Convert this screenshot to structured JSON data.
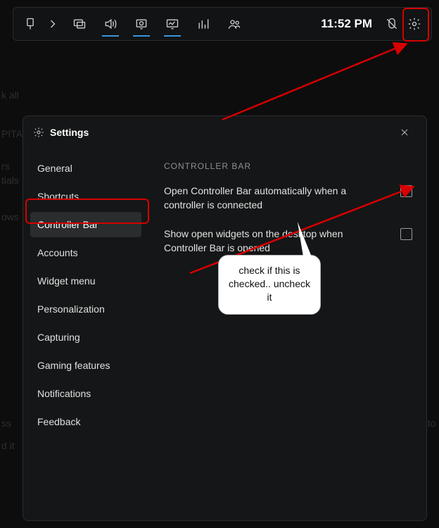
{
  "topbar": {
    "time": "11:52 PM",
    "icons": {
      "pin": "pin-icon",
      "chevron": "chevron-right-icon",
      "monitor": "monitor-icon",
      "volume": "volume-icon",
      "camera": "camera-icon",
      "perf": "performance-icon",
      "stats": "bar-chart-icon",
      "group": "group-icon",
      "mouse_off": "mouse-disabled-icon",
      "gear": "gear-icon"
    }
  },
  "background_fragments": {
    "a": "k all",
    "b": "PITA",
    "c": "rs",
    "d": "tials",
    "e": "ows",
    "f": "ss",
    "g": "d it",
    "h": "uto"
  },
  "panel": {
    "title": "Settings",
    "sidebar": {
      "items": [
        {
          "label": "General"
        },
        {
          "label": "Shortcuts"
        },
        {
          "label": "Controller Bar",
          "selected": true
        },
        {
          "label": "Accounts"
        },
        {
          "label": "Widget menu"
        },
        {
          "label": "Personalization"
        },
        {
          "label": "Capturing"
        },
        {
          "label": "Gaming features"
        },
        {
          "label": "Notifications"
        },
        {
          "label": "Feedback"
        }
      ]
    },
    "content": {
      "section": "CONTROLLER BAR",
      "rows": [
        {
          "text": "Open Controller Bar automatically when a controller is connected",
          "checked": false
        },
        {
          "text": "Show open widgets on the desktop when Controller Bar is opened",
          "checked": false
        }
      ]
    }
  },
  "annotation": {
    "callout": "check if this is checked.. uncheck it"
  }
}
